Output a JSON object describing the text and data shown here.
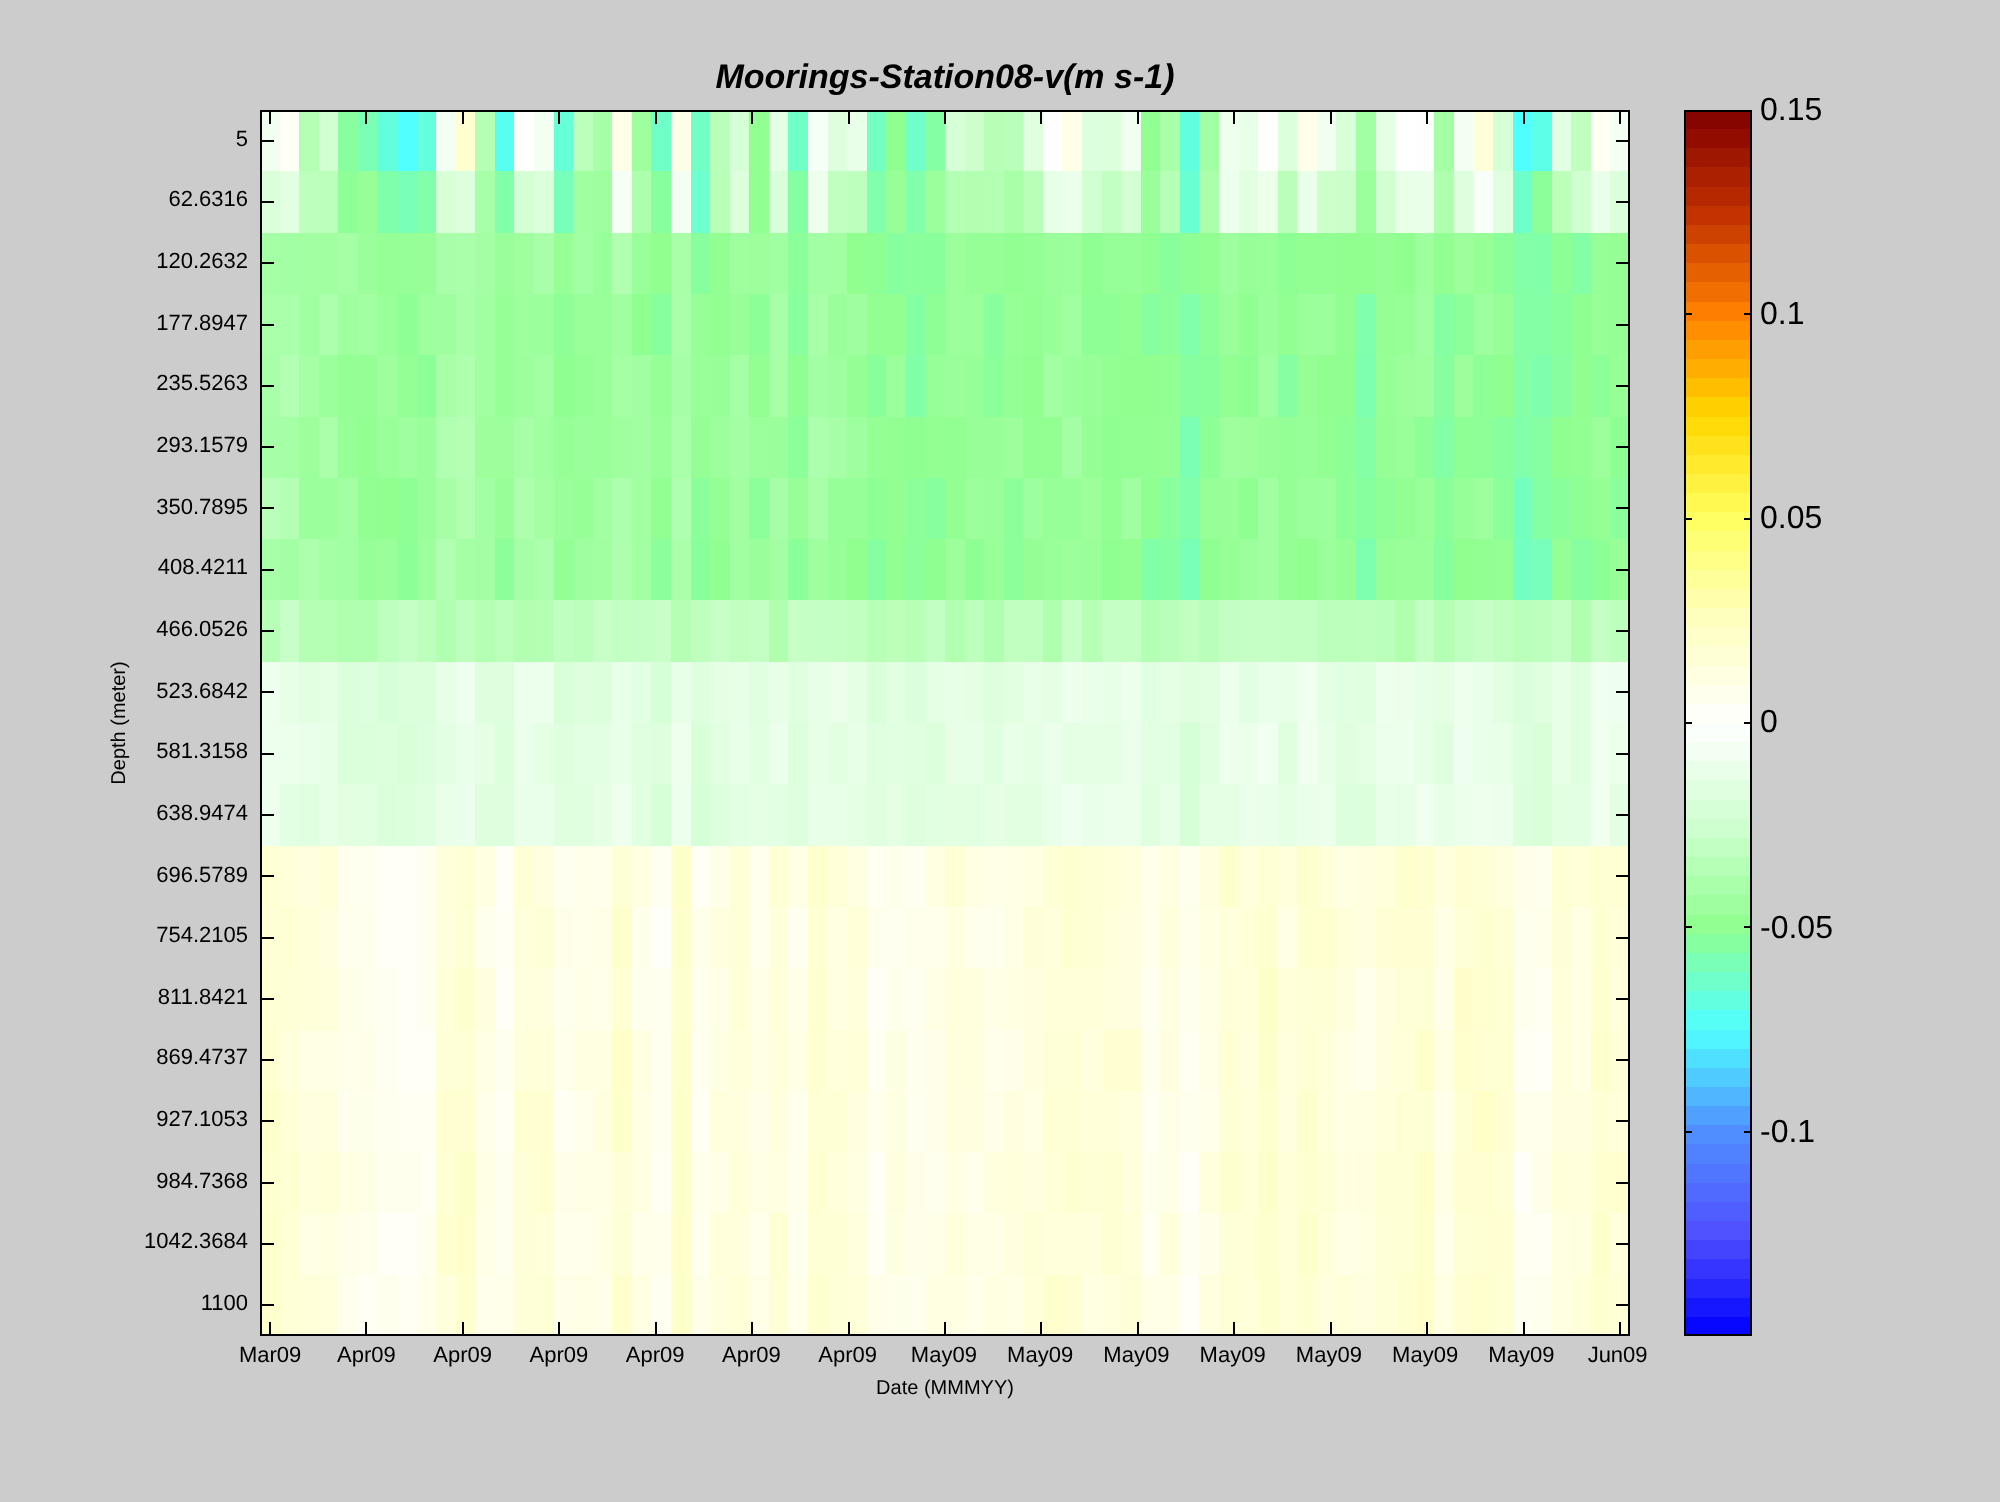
{
  "title": "Moorings-Station08-v(m s-1)",
  "y_axis": {
    "label": "Depth (meter)",
    "ticks": [
      "5",
      "62.6316",
      "120.2632",
      "177.8947",
      "235.5263",
      "293.1579",
      "350.7895",
      "408.4211",
      "466.0526",
      "523.6842",
      "581.3158",
      "638.9474",
      "696.5789",
      "754.2105",
      "811.8421",
      "869.4737",
      "927.1053",
      "984.7368",
      "1042.3684",
      "1100"
    ]
  },
  "x_axis": {
    "label": "Date (MMMYY)",
    "ticks": [
      "Mar09",
      "Apr09",
      "Apr09",
      "Apr09",
      "Apr09",
      "Apr09",
      "Apr09",
      "May09",
      "May09",
      "May09",
      "May09",
      "May09",
      "May09",
      "May09",
      "Jun09"
    ]
  },
  "colorbar": {
    "ticks": [
      "0.15",
      "0.1",
      "0.05",
      "0",
      "-0.05",
      "-0.1"
    ]
  }
}
